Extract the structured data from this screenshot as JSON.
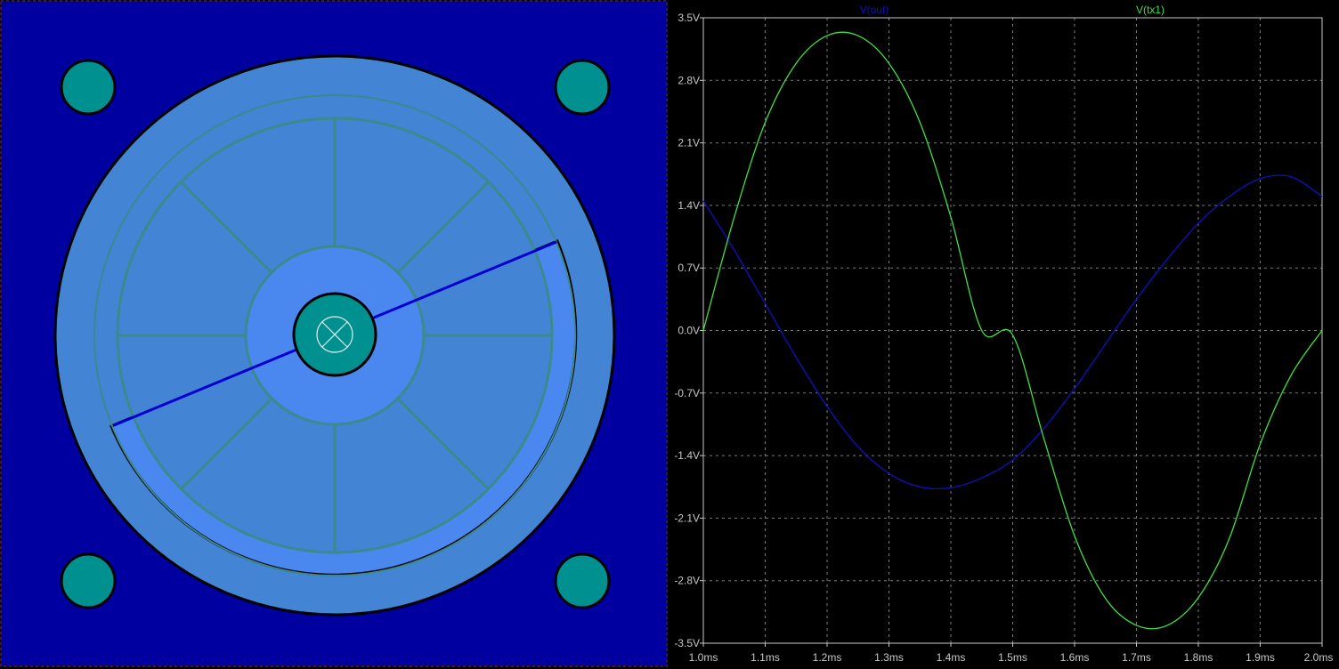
{
  "colors": {
    "board": "#0000a0",
    "disc": "#4484d4",
    "ring": "#4a88f0",
    "spoke": "#3c8a8c",
    "pad": "#009090",
    "wiper": "#0000d0",
    "grid": "#7a7a7a",
    "axis": "#c8c8c8",
    "series_out": "#1010c0",
    "series_tx1": "#40e040"
  },
  "chart_data": {
    "type": "line",
    "xlabel": "",
    "ylabel": "",
    "xlim": [
      1.0,
      2.0
    ],
    "ylim": [
      -3.5,
      3.5
    ],
    "grid": true,
    "legend_position": "top",
    "x_ticks": [
      "1.0ms",
      "1.1ms",
      "1.2ms",
      "1.3ms",
      "1.4ms",
      "1.5ms",
      "1.6ms",
      "1.7ms",
      "1.8ms",
      "1.9ms",
      "2.0ms"
    ],
    "y_ticks": [
      "3.5V",
      "2.8V",
      "2.1V",
      "1.4V",
      "0.7V",
      "0.0V",
      "-0.7V",
      "-1.4V",
      "-2.1V",
      "-2.8V",
      "-3.5V"
    ],
    "x_tick_values": [
      1.0,
      1.1,
      1.2,
      1.3,
      1.4,
      1.5,
      1.6,
      1.7,
      1.8,
      1.9,
      2.0
    ],
    "y_tick_values": [
      3.5,
      2.8,
      2.1,
      1.4,
      0.7,
      0.0,
      -0.7,
      -1.4,
      -2.1,
      -2.8,
      -3.5
    ],
    "series": [
      {
        "name": "V(out)",
        "color": "#1010c0",
        "x": [
          1.0,
          1.05,
          1.1,
          1.15,
          1.2,
          1.25,
          1.3,
          1.35,
          1.4,
          1.45,
          1.5,
          1.55,
          1.6,
          1.65,
          1.7,
          1.75,
          1.8,
          1.85,
          1.9,
          1.95,
          2.0
        ],
        "y": [
          1.45,
          0.9,
          0.3,
          -0.3,
          -0.85,
          -1.3,
          -1.6,
          -1.75,
          -1.76,
          -1.65,
          -1.45,
          -1.1,
          -0.65,
          -0.15,
          0.35,
          0.8,
          1.2,
          1.5,
          1.7,
          1.72,
          1.5
        ]
      },
      {
        "name": "V(tx1)",
        "color": "#40e040",
        "x": [
          1.0,
          1.05,
          1.1,
          1.15,
          1.2,
          1.25,
          1.3,
          1.35,
          1.4,
          1.45,
          1.5,
          1.55,
          1.6,
          1.65,
          1.7,
          1.75,
          1.8,
          1.85,
          1.9,
          1.95,
          2.0
        ],
        "y": [
          0.0,
          1.27,
          2.33,
          2.99,
          3.3,
          3.3,
          2.99,
          2.33,
          1.27,
          0.0,
          -0.05,
          -1.2,
          -2.3,
          -3.0,
          -3.3,
          -3.3,
          -2.99,
          -2.33,
          -1.27,
          -0.5,
          0.0
        ]
      }
    ]
  }
}
